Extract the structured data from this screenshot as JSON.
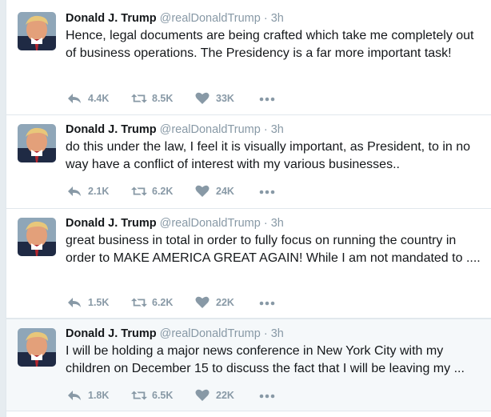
{
  "tweets": [
    {
      "name": "Donald J. Trump",
      "handle": "@realDonaldTrump",
      "separator": "·",
      "time": "3h",
      "text": "Hence, legal documents are being crafted which take me completely out of business operations. The Presidency is a far more important task!",
      "replies": "4.4K",
      "retweets": "8.5K",
      "likes": "33K"
    },
    {
      "name": "Donald J. Trump",
      "handle": "@realDonaldTrump",
      "separator": "·",
      "time": "3h",
      "text": "do this under the law, I feel it is visually important, as President,  to in no way have a conflict of interest with my various businesses..",
      "replies": "2.1K",
      "retweets": "6.2K",
      "likes": "24K"
    },
    {
      "name": "Donald J. Trump",
      "handle": "@realDonaldTrump",
      "separator": "·",
      "time": "3h",
      "text": "great business in total in order to fully focus on running the country in order to MAKE AMERICA GREAT AGAIN! While I am not mandated to ....",
      "replies": "1.5K",
      "retweets": "6.2K",
      "likes": "22K"
    },
    {
      "name": "Donald J. Trump",
      "handle": "@realDonaldTrump",
      "separator": "·",
      "time": "3h",
      "text": "I will be holding a major news conference in New York City with my children on December 15 to discuss the fact that I will be leaving my ...",
      "replies": "1.8K",
      "retweets": "6.5K",
      "likes": "22K"
    }
  ],
  "icons": {
    "reply": "reply-icon",
    "retweet": "retweet-icon",
    "like": "heart-icon",
    "more": "more-dots-icon"
  },
  "colors": {
    "name": "#14171a",
    "meta": "#8899a6",
    "divider": "#e1e8ed",
    "highlight_background": "#f5f8fa"
  }
}
